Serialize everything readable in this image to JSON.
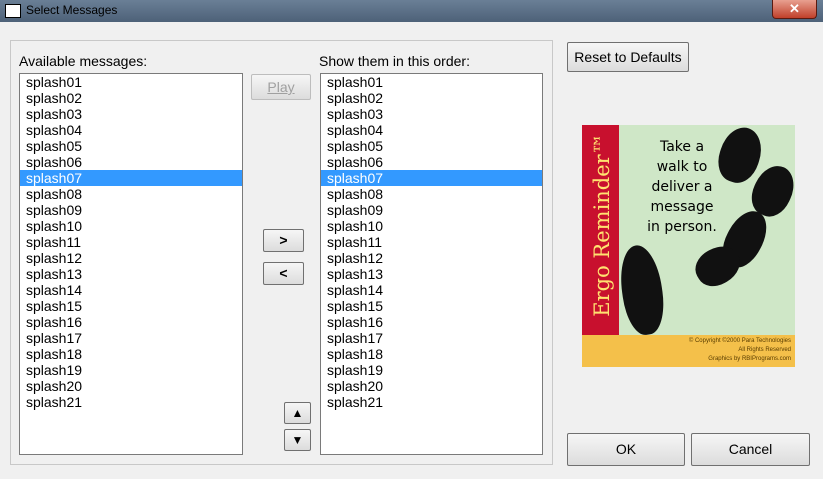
{
  "window": {
    "title": "Select Messages",
    "close_glyph": "✕"
  },
  "available": {
    "label": "Available messages:",
    "items": [
      "splash01",
      "splash02",
      "splash03",
      "splash04",
      "splash05",
      "splash06",
      "splash07",
      "splash08",
      "splash09",
      "splash10",
      "splash11",
      "splash12",
      "splash13",
      "splash14",
      "splash15",
      "splash16",
      "splash17",
      "splash18",
      "splash19",
      "splash20",
      "splash21"
    ],
    "selected": "splash07"
  },
  "order": {
    "label": "Show them in this order:",
    "items": [
      "splash01",
      "splash02",
      "splash03",
      "splash04",
      "splash05",
      "splash06",
      "splash07",
      "splash08",
      "splash09",
      "splash10",
      "splash11",
      "splash12",
      "splash13",
      "splash14",
      "splash15",
      "splash16",
      "splash17",
      "splash18",
      "splash19",
      "splash20",
      "splash21"
    ],
    "selected": "splash07"
  },
  "buttons": {
    "play": "Play",
    "add": ">",
    "remove": "<",
    "move_up": "▲",
    "move_down": "▼",
    "reset": "Reset to Defaults",
    "ok": "OK",
    "cancel": "Cancel"
  },
  "logo": {
    "product": "Ergo Reminder™",
    "tagline_lines": [
      "Take a",
      "walk to",
      "deliver a",
      "message",
      "in person."
    ],
    "footer_lines": [
      "© Copyright ©2000 Para Technologies",
      "All Rights Reserved",
      "Graphics by RBIPrograms.com"
    ]
  },
  "colors": {
    "selection": "#3399ff",
    "logo_red": "#c8102e",
    "logo_green": "#cfe7c7",
    "logo_yellow": "#f4c04a"
  }
}
